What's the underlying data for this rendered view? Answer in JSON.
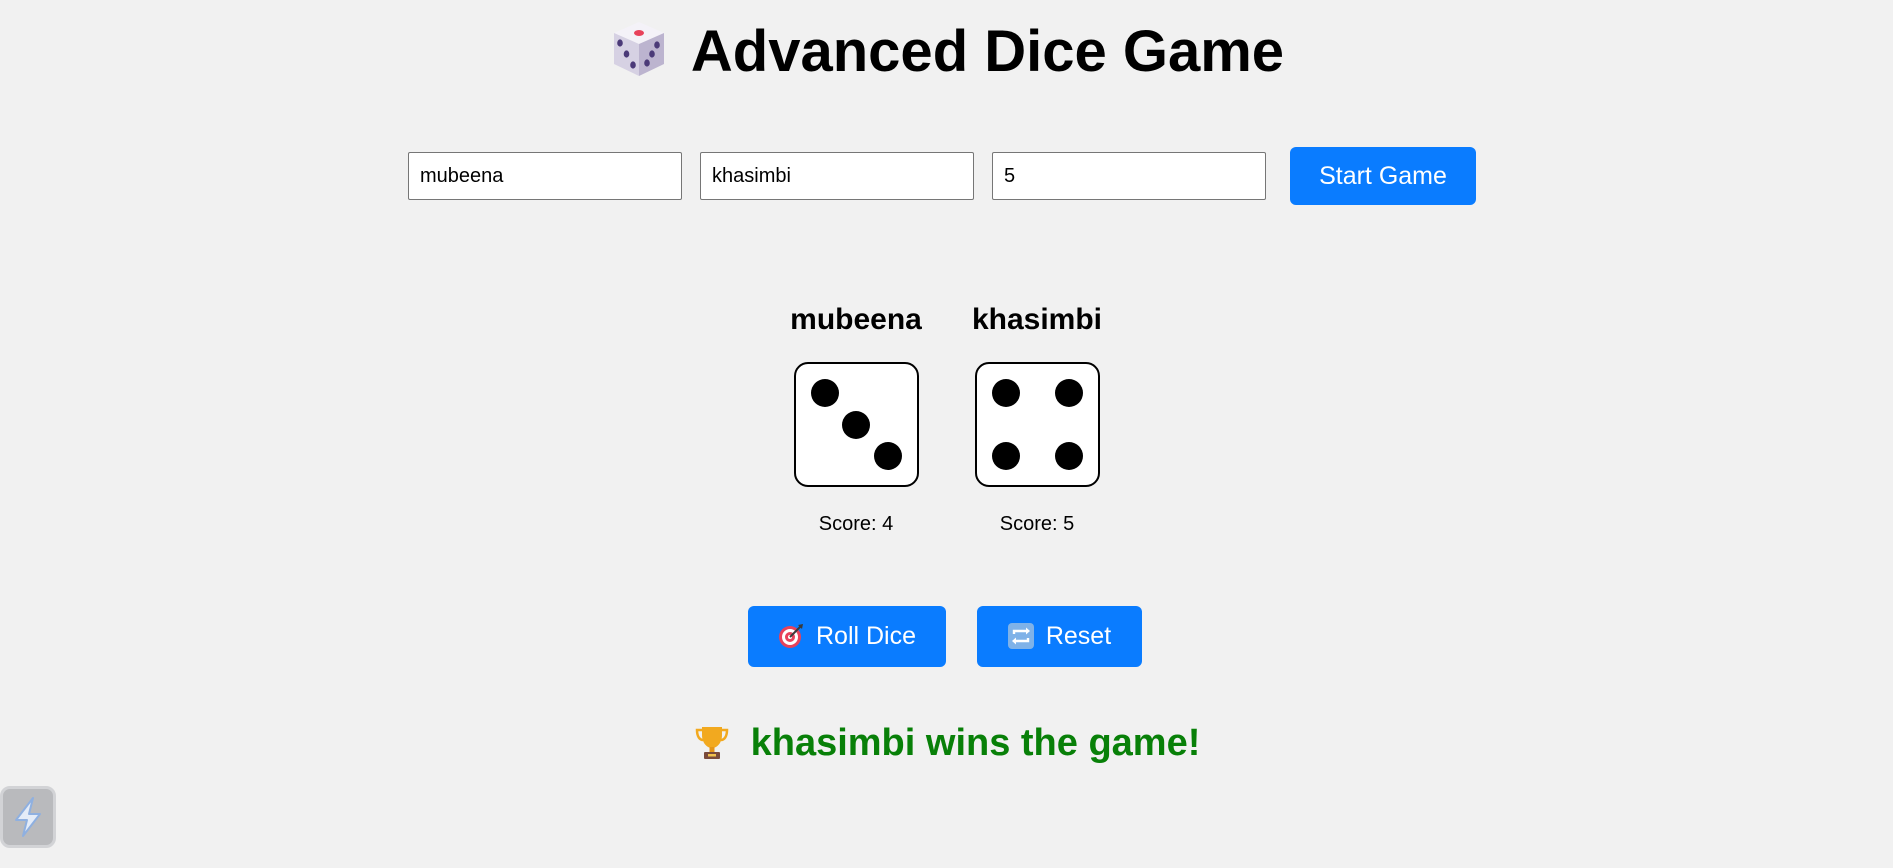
{
  "header": {
    "title": "Advanced Dice Game",
    "icon": "die-icon"
  },
  "setup": {
    "player1_value": "mubeena",
    "player2_value": "khasimbi",
    "rounds_value": "5",
    "start_label": "Start Game"
  },
  "players": [
    {
      "name": "mubeena",
      "die_face": 3,
      "score_text": "Score: 4"
    },
    {
      "name": "khasimbi",
      "die_face": 4,
      "score_text": "Score: 5"
    }
  ],
  "actions": {
    "roll_label": "Roll Dice",
    "roll_icon": "target-icon",
    "reset_label": "Reset",
    "reset_icon": "repeat-icon"
  },
  "result": {
    "text": "khasimbi wins the game!",
    "icon": "trophy-icon",
    "color": "#088008"
  },
  "colors": {
    "accent": "#0a7cff",
    "background": "#f1f1f1"
  }
}
